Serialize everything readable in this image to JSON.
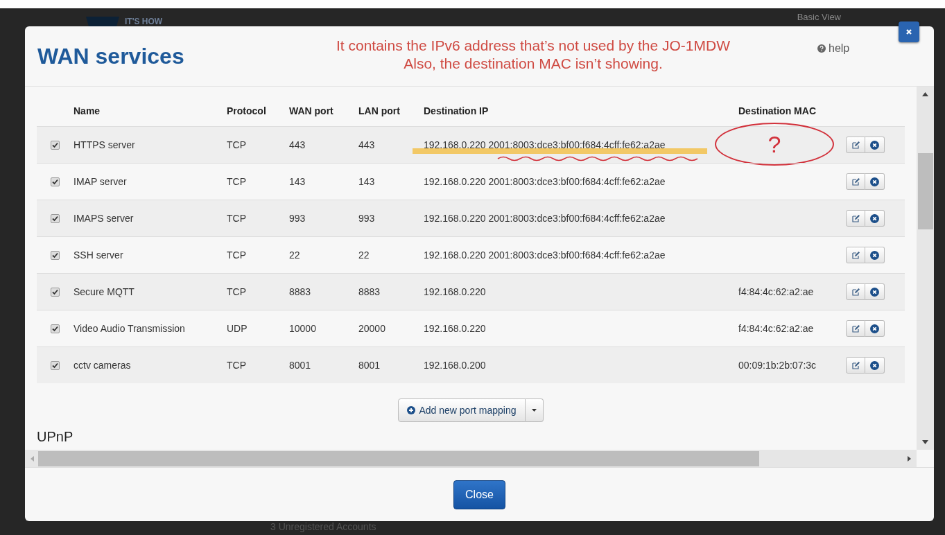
{
  "background": {
    "brand": "IT'S HOW",
    "nav": [
      "Basic View"
    ],
    "footer_text": "3 Unregistered Accounts"
  },
  "dialog": {
    "title": "WAN services",
    "note_lines": [
      "It contains the IPv6 address that’s not used by the JO-1MDW",
      "Also, the destination MAC isn’t showing."
    ],
    "help": "help"
  },
  "table": {
    "columns": [
      "Name",
      "Protocol",
      "WAN port",
      "LAN port",
      "Destination IP",
      "Destination MAC"
    ],
    "rows": [
      {
        "checked": true,
        "name": "HTTPS server",
        "protocol": "TCP",
        "wan_port": "443",
        "lan_port": "443",
        "destination_ip": "192.168.0.220 2001:8003:dce3:bf00:f684:4cff:fe62:a2ae",
        "destination_mac": "",
        "annotation": "?"
      },
      {
        "checked": true,
        "name": "IMAP server",
        "protocol": "TCP",
        "wan_port": "143",
        "lan_port": "143",
        "destination_ip": "192.168.0.220 2001:8003:dce3:bf00:f684:4cff:fe62:a2ae",
        "destination_mac": ""
      },
      {
        "checked": true,
        "name": "IMAPS server",
        "protocol": "TCP",
        "wan_port": "993",
        "lan_port": "993",
        "destination_ip": "192.168.0.220 2001:8003:dce3:bf00:f684:4cff:fe62:a2ae",
        "destination_mac": ""
      },
      {
        "checked": true,
        "name": "SSH server",
        "protocol": "TCP",
        "wan_port": "22",
        "lan_port": "22",
        "destination_ip": "192.168.0.220 2001:8003:dce3:bf00:f684:4cff:fe62:a2ae",
        "destination_mac": ""
      },
      {
        "checked": true,
        "name": "Secure MQTT",
        "protocol": "TCP",
        "wan_port": "8883",
        "lan_port": "8883",
        "destination_ip": "192.168.0.220",
        "destination_mac": "f4:84:4c:62:a2:ae"
      },
      {
        "checked": true,
        "name": "Video Audio Transmission",
        "protocol": "UDP",
        "wan_port": "10000",
        "lan_port": "20000",
        "destination_ip": "192.168.0.220",
        "destination_mac": "f4:84:4c:62:a2:ae"
      },
      {
        "checked": true,
        "name": "cctv cameras",
        "protocol": "TCP",
        "wan_port": "8001",
        "lan_port": "8001",
        "destination_ip": "192.168.0.200",
        "destination_mac": "00:09:1b:2b:07:3c"
      }
    ]
  },
  "add_button": "Add new port mapping",
  "section_heading": "UPnP",
  "close_button": "Close"
}
